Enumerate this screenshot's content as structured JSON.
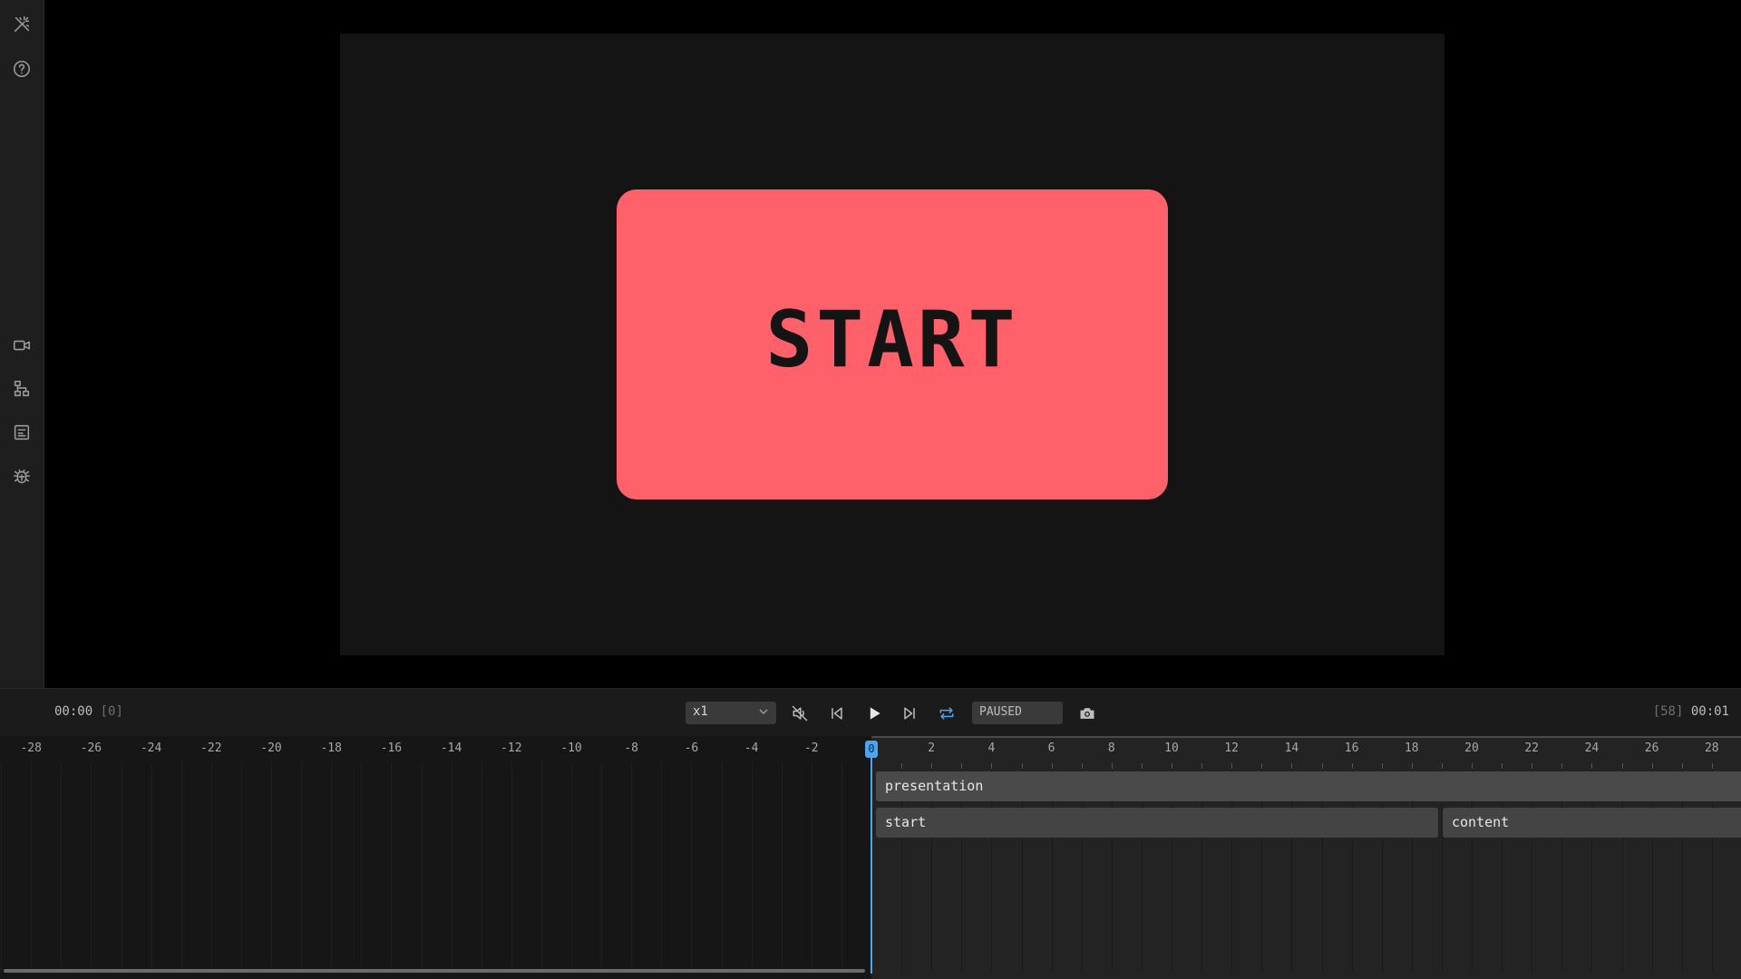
{
  "sidebar": {
    "icons": [
      "wand-icon",
      "help-icon",
      "video-icon",
      "scene-graph-icon",
      "properties-icon",
      "debug-icon"
    ]
  },
  "stage": {
    "button_label": "START",
    "button_color": "#ff616b",
    "background": "#141414"
  },
  "playback": {
    "current_time": "00:00",
    "current_frame": "[0]",
    "speed": "x1",
    "status": "PAUSED",
    "end_frame": "[58]",
    "end_time": "00:01",
    "accent_color": "#4aa6f3"
  },
  "timeline": {
    "ticks": [
      "-28",
      "-26",
      "-24",
      "-22",
      "-20",
      "-18",
      "-16",
      "-14",
      "-12",
      "-10",
      "-8",
      "-6",
      "-4",
      "-2",
      "0",
      "2",
      "4",
      "6",
      "8",
      "10",
      "12",
      "14",
      "16",
      "18",
      "20",
      "22",
      "24",
      "26",
      "28"
    ],
    "playhead_label": "0",
    "tracks": {
      "presentation": "presentation",
      "start": "start",
      "content": "content"
    }
  }
}
